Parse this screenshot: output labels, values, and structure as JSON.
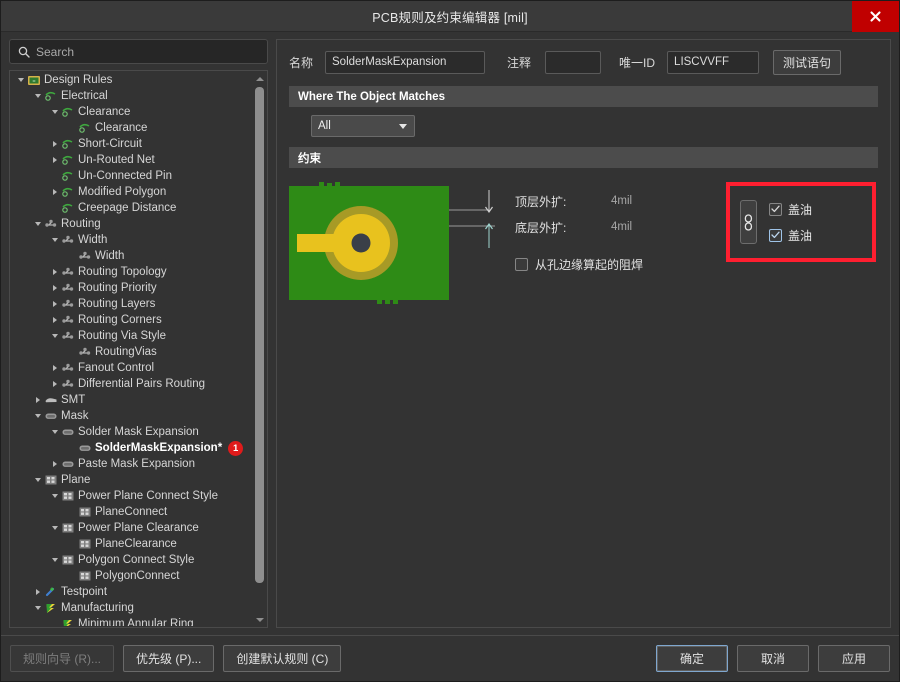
{
  "window": {
    "title": "PCB规则及约束编辑器 [mil]",
    "close_label": "×"
  },
  "sidebar": {
    "search": {
      "placeholder": "Search",
      "value": ""
    },
    "tree": [
      {
        "label": "Design Rules",
        "depth": 0,
        "arrow": "expanded",
        "icon": "design-rules-icon"
      },
      {
        "label": "Electrical",
        "depth": 1,
        "arrow": "expanded",
        "icon": "electrical-icon"
      },
      {
        "label": "Clearance",
        "depth": 2,
        "arrow": "expanded",
        "icon": "electrical-icon"
      },
      {
        "label": "Clearance",
        "depth": 3,
        "arrow": "none",
        "icon": "electrical-icon"
      },
      {
        "label": "Short-Circuit",
        "depth": 2,
        "arrow": "collapsed",
        "icon": "electrical-icon"
      },
      {
        "label": "Un-Routed Net",
        "depth": 2,
        "arrow": "collapsed",
        "icon": "electrical-icon"
      },
      {
        "label": "Un-Connected Pin",
        "depth": 2,
        "arrow": "none",
        "icon": "electrical-icon"
      },
      {
        "label": "Modified Polygon",
        "depth": 2,
        "arrow": "collapsed",
        "icon": "electrical-icon"
      },
      {
        "label": "Creepage Distance",
        "depth": 2,
        "arrow": "none",
        "icon": "electrical-icon"
      },
      {
        "label": "Routing",
        "depth": 1,
        "arrow": "expanded",
        "icon": "routing-icon"
      },
      {
        "label": "Width",
        "depth": 2,
        "arrow": "expanded",
        "icon": "routing-icon"
      },
      {
        "label": "Width",
        "depth": 3,
        "arrow": "none",
        "icon": "routing-icon"
      },
      {
        "label": "Routing Topology",
        "depth": 2,
        "arrow": "collapsed",
        "icon": "routing-icon"
      },
      {
        "label": "Routing Priority",
        "depth": 2,
        "arrow": "collapsed",
        "icon": "routing-icon"
      },
      {
        "label": "Routing Layers",
        "depth": 2,
        "arrow": "collapsed",
        "icon": "routing-icon"
      },
      {
        "label": "Routing Corners",
        "depth": 2,
        "arrow": "collapsed",
        "icon": "routing-icon"
      },
      {
        "label": "Routing Via Style",
        "depth": 2,
        "arrow": "expanded",
        "icon": "routing-icon"
      },
      {
        "label": "RoutingVias",
        "depth": 3,
        "arrow": "none",
        "icon": "routing-icon"
      },
      {
        "label": "Fanout Control",
        "depth": 2,
        "arrow": "collapsed",
        "icon": "routing-icon"
      },
      {
        "label": "Differential Pairs Routing",
        "depth": 2,
        "arrow": "collapsed",
        "icon": "routing-icon"
      },
      {
        "label": "SMT",
        "depth": 1,
        "arrow": "collapsed",
        "icon": "smt-icon"
      },
      {
        "label": "Mask",
        "depth": 1,
        "arrow": "expanded",
        "icon": "mask-icon"
      },
      {
        "label": "Solder Mask Expansion",
        "depth": 2,
        "arrow": "expanded",
        "icon": "mask-icon"
      },
      {
        "label": "SolderMaskExpansion*",
        "depth": 3,
        "arrow": "none",
        "icon": "mask-icon",
        "selected": true,
        "badge": "1"
      },
      {
        "label": "Paste Mask Expansion",
        "depth": 2,
        "arrow": "collapsed",
        "icon": "mask-icon"
      },
      {
        "label": "Plane",
        "depth": 1,
        "arrow": "expanded",
        "icon": "plane-icon"
      },
      {
        "label": "Power Plane Connect Style",
        "depth": 2,
        "arrow": "expanded",
        "icon": "plane-icon"
      },
      {
        "label": "PlaneConnect",
        "depth": 3,
        "arrow": "none",
        "icon": "plane-icon"
      },
      {
        "label": "Power Plane Clearance",
        "depth": 2,
        "arrow": "expanded",
        "icon": "plane-icon"
      },
      {
        "label": "PlaneClearance",
        "depth": 3,
        "arrow": "none",
        "icon": "plane-icon"
      },
      {
        "label": "Polygon Connect Style",
        "depth": 2,
        "arrow": "expanded",
        "icon": "plane-icon"
      },
      {
        "label": "PolygonConnect",
        "depth": 3,
        "arrow": "none",
        "icon": "plane-icon"
      },
      {
        "label": "Testpoint",
        "depth": 1,
        "arrow": "collapsed",
        "icon": "testpoint-icon"
      },
      {
        "label": "Manufacturing",
        "depth": 1,
        "arrow": "expanded",
        "icon": "manufacturing-icon"
      },
      {
        "label": "Minimum Annular Ring",
        "depth": 2,
        "arrow": "none",
        "icon": "manufacturing-icon"
      }
    ]
  },
  "form": {
    "name_label": "名称",
    "name_value": "SolderMaskExpansion",
    "comment_label": "注释",
    "comment_value": "",
    "unique_id_label": "唯一ID",
    "unique_id_value": "LISCVVFF",
    "test_query_button": "测试语句"
  },
  "match_section": {
    "title": "Where The Object Matches",
    "scope_value": "All"
  },
  "constraint_section": {
    "title": "约束",
    "top_expansion_label": "顶层外扩:",
    "top_expansion_value": "4mil",
    "bottom_expansion_label": "底层外扩:",
    "bottom_expansion_value": "4mil",
    "from_hole_edge_label": "从孔边缘算起的阻焊",
    "from_hole_edge_checked": false,
    "highlight_color": "#ff1f30",
    "link_icon": "chain-link-icon",
    "cover_rows": [
      {
        "label": "盖油",
        "checked": true
      },
      {
        "label": "盖油",
        "checked": true
      }
    ],
    "pcb_preview": {
      "board_color": "#2e8b16",
      "pad_color": "#e8c21e",
      "ring_color": "#b5a82a",
      "hole_color": "#3a3f48"
    }
  },
  "footer": {
    "rule_wizard": "规则向导 (R)...",
    "priority": "优先级 (P)...",
    "create_default_rules": "创建默认规则 (C)",
    "ok": "确定",
    "cancel": "取消",
    "apply": "应用"
  }
}
